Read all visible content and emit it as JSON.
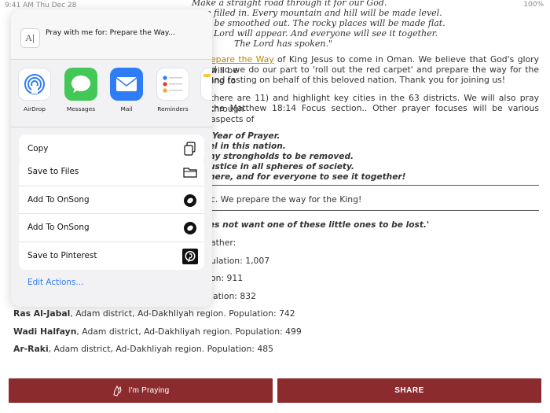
{
  "status_bar": {
    "time_date": "9:41 AM  Thu Dec 28",
    "battery": "100%"
  },
  "article": {
    "verse_lines": [
      "Make a straight road through it for our God.",
      "e filled in. Every mountain and hill will be made level.",
      "ll be smoothed out. The rocky places will be made flat.",
      "e Lord will appear. And everyone will see it together.",
      "The Lord has spoken.\""
    ],
    "para1_prefix": "",
    "para1_link": "epare the Way",
    "para1_rest": " of King Jesus to come in Oman. We believe that God's glory will be",
    "para1_line2": "nd so we do our part to 'roll out the red carpet' and prepare the way for the King to",
    "para1_line3": "and fasting on behalf of this beloved nation. Thank you for joining us!",
    "para2_line1": "there are 11) and highlight key cities in the 63 districts. We will also pray through",
    "para2_line2": "the Matthew 18:14 Focus section.. Other prayer focuses will be various aspects of",
    "bold_lines": [
      "Year of Prayer.",
      "el in this nation.",
      "ny strongholds to be removed.",
      "ustice in all spheres of society.",
      "here, and for everyone to see it together!"
    ],
    "prepare_line": "c. We prepare the way for the King!",
    "matthew_line": "es not want one of these little ones to be lost.'",
    "father_line": "ather:",
    "pop1": "ulation: 1,007",
    "pop2": "on: 911",
    "pop3": "lation: 832",
    "cities": [
      {
        "name": "Ras Al-Jabal",
        "detail": ", Adam district, Ad-Dakhliyah region. Population: 742"
      },
      {
        "name": "Wadi Halfayn",
        "detail": ", Adam district, Ad-Dakhliyah region. Population: 499"
      },
      {
        "name": "Ar-Raki",
        "detail": ", Adam district, Ad-Dakhliyah region. Population: 485"
      }
    ]
  },
  "buttons": {
    "praying": "I'm Praying",
    "share": "SHARE"
  },
  "share_sheet": {
    "title": "Pray with me for:  Prepare the Way...",
    "apps": [
      "AirDrop",
      "Messages",
      "Mail",
      "Reminders"
    ],
    "actions_group1": [
      "Copy"
    ],
    "actions_group2": [
      "Save to Files",
      "Add To OnSong",
      "Add To OnSong",
      "Save to Pinterest"
    ],
    "edit_actions": "Edit Actions..."
  },
  "colors": {
    "button_bg": "#8b2b2e",
    "link": "#b8860b",
    "ios_blue": "#2f7df6"
  }
}
